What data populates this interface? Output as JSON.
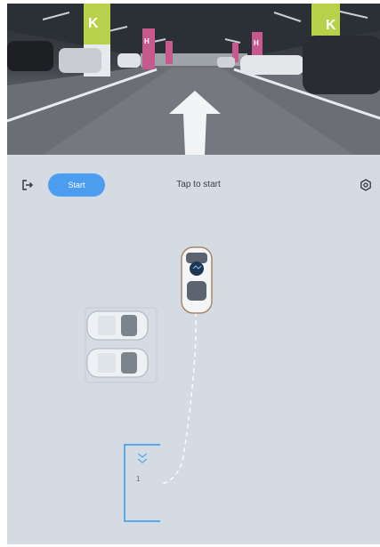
{
  "header": {
    "start_label": "Start",
    "status_text": "Tap to start"
  },
  "parking": {
    "target_slot_number": "1"
  },
  "camera_signs": [
    {
      "letter": "K"
    },
    {
      "letter": "K"
    },
    {
      "letter": "H"
    },
    {
      "letter": "H"
    }
  ],
  "colors": {
    "accent": "#4c9df0",
    "panel_background": "#d5dbe2",
    "path_line": "#ffffff"
  },
  "icons": {
    "exit": "exit-icon",
    "settings": "settings-icon",
    "ego_vehicle": "car-top-icon",
    "slot_indicator": "chevron-down-icon"
  }
}
